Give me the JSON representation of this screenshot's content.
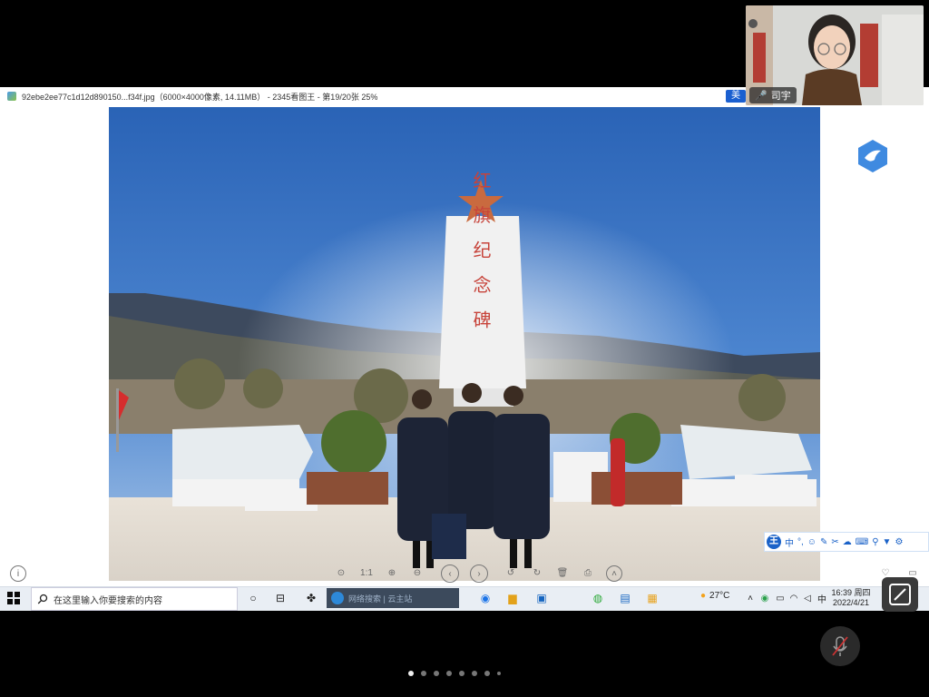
{
  "viewer": {
    "window_title": "92ebe2ee77c1d12d890150...f34f.jpg（6000×4000像素, 14.11MB） - 2345看图王 - 第19/20张 25%",
    "ime_badge": "美",
    "toolbar": {
      "ratio_label": "1:1"
    }
  },
  "photo": {
    "monument_text": "红 旗 纪 念 碑"
  },
  "ime": {
    "logo_letter": "王",
    "mode_label": "中"
  },
  "taskbar": {
    "search_placeholder": "在这里输入你要搜索的内容",
    "edge_search_placeholder": "网络搜索 | 云主站",
    "weather": "27°C",
    "time": "16:39 周四",
    "date": "2022/4/21"
  },
  "meeting": {
    "speaker_name": "司宇",
    "page_count": 8,
    "active_page": 1
  },
  "colors": {
    "brand_blue": "#1a62c8",
    "taskbar_bg": "#e9eef4",
    "meeting_bg": "#000000"
  }
}
